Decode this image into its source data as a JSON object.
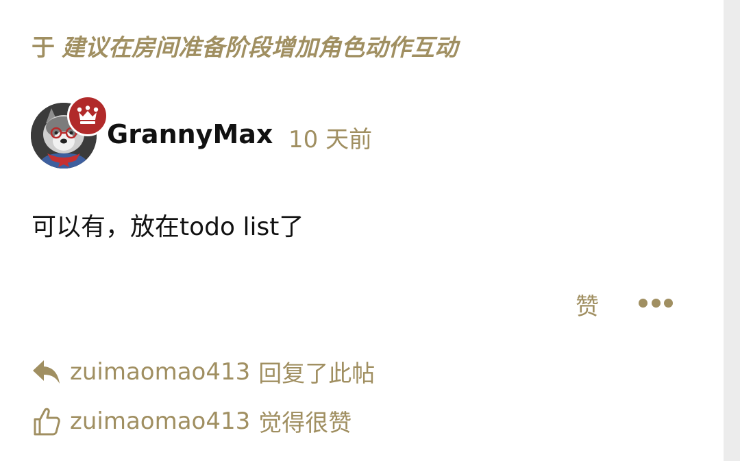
{
  "context": {
    "prefix": "于",
    "topic_title": "建议在房间准备阶段增加角色动作互动"
  },
  "post": {
    "username": "GrannyMax",
    "time": "10 天前",
    "body": "可以有，放在todo list了",
    "avatar_icon": "husky-avatar",
    "badge_icon": "crown-icon"
  },
  "actions": {
    "like_label": "赞",
    "more_icon": "ellipsis-icon"
  },
  "activity": [
    {
      "icon": "reply-arrow-icon",
      "user": "zuimaomao413",
      "text": "回复了此帖"
    },
    {
      "icon": "thumbs-up-icon",
      "user": "zuimaomao413",
      "text": "觉得很赞"
    }
  ],
  "colors": {
    "accent": "#a08f61",
    "badge": "#b12a2a",
    "text": "#111111",
    "gutter": "#ececec"
  }
}
